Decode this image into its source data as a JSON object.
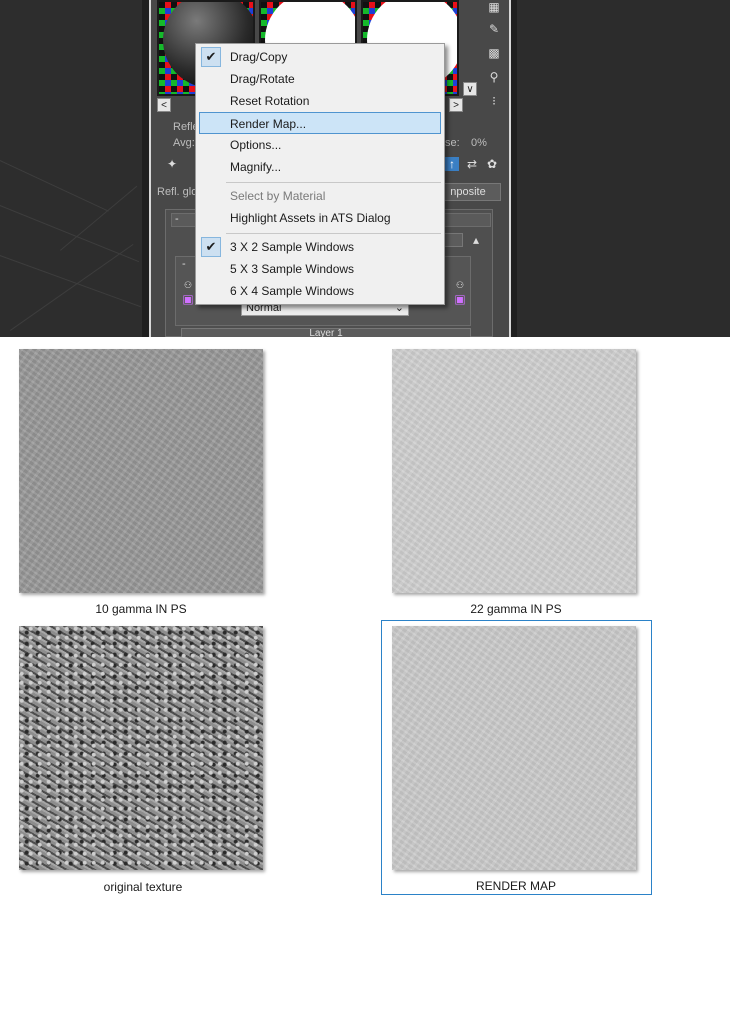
{
  "material_editor": {
    "labels": {
      "reflect": "Refle",
      "avg": "Avg:",
      "se": "se:",
      "percent": "0%",
      "refl_glossiness": "Refl. glo",
      "composite": "nposite",
      "blend_mode": "Normal",
      "layer": "Layer 1",
      "collapse": "-"
    }
  },
  "context_menu": {
    "items": [
      {
        "label": "Drag/Copy",
        "checked": true
      },
      {
        "label": "Drag/Rotate"
      },
      {
        "label": "Reset Rotation"
      },
      {
        "label": "Render Map...",
        "highlighted": true
      },
      {
        "label": "Options..."
      },
      {
        "label": "Magnify..."
      },
      {
        "label": "Select by Material",
        "disabled": true
      },
      {
        "label": "Highlight Assets in ATS Dialog"
      },
      {
        "label": "3 X 2 Sample Windows",
        "checked": true
      },
      {
        "label": "5 X 3 Sample Windows"
      },
      {
        "label": "6 X 4 Sample Windows"
      }
    ]
  },
  "textures": [
    {
      "caption": "10 gamma IN PS"
    },
    {
      "caption": "22 gamma IN PS"
    },
    {
      "caption": "original texture"
    },
    {
      "caption": "RENDER MAP"
    }
  ],
  "colors": {
    "menu_highlight": "#cce4f7",
    "menu_highlight_border": "#4f94cf",
    "selection_frame": "#2b82c8"
  }
}
